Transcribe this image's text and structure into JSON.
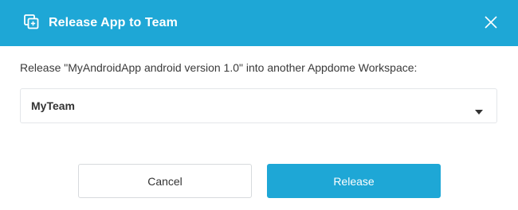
{
  "dialog": {
    "title": "Release App to Team",
    "header_icon": "release-copy-icon",
    "close_icon": "close-icon",
    "message": "Release \"MyAndroidApp android version 1.0\" into another Appdome Workspace:",
    "team_select": {
      "selected_value": "MyTeam",
      "caret_icon": "caret-down-icon"
    },
    "buttons": {
      "cancel_label": "Cancel",
      "release_label": "Release"
    }
  },
  "colors": {
    "accent": "#1ea7d6",
    "text": "#3a3a3a",
    "border": "#e3e6e9"
  }
}
